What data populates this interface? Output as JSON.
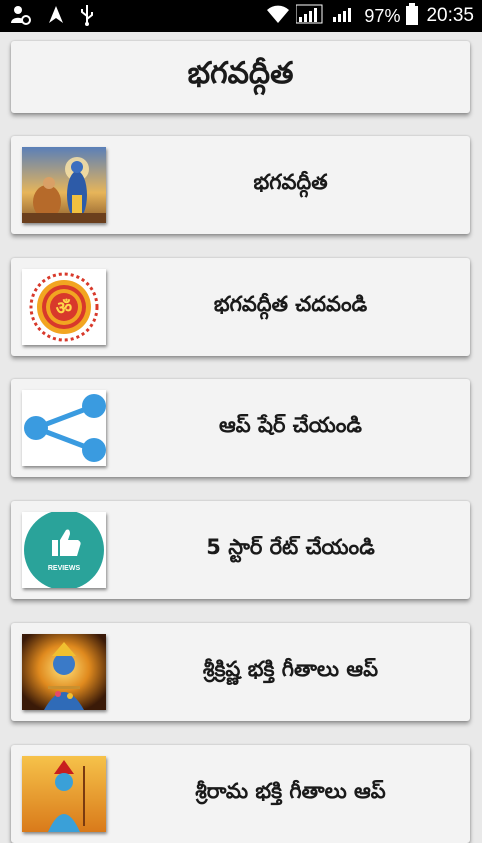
{
  "status_bar": {
    "battery": "97%",
    "time": "20:35",
    "icons": [
      "settings-person-icon",
      "navigation-icon",
      "usb-icon",
      "wifi-icon",
      "signal-icon",
      "signal-icon",
      "battery-icon"
    ]
  },
  "header": {
    "title": "భగవద్గీత"
  },
  "menu": {
    "items": [
      {
        "label": "భగవద్గీత",
        "thumb": "krishna-arjuna-image"
      },
      {
        "label": "భగవద్గీత చదవండి",
        "thumb": "om-mandala-image"
      },
      {
        "label": "ఆప్ షేర్ చేయండి",
        "thumb": "share-icon"
      },
      {
        "label": "5 స్టార్ రేట్ చేయండి",
        "thumb": "reviews-thumbs-up-icon",
        "thumb_text": "REVIEWS"
      },
      {
        "label": "శ్రీక్రిష్ణ భక్తి గీతాలు ఆప్",
        "thumb": "krishna-image"
      },
      {
        "label": "శ్రీరామ భక్తి గీతాలు ఆప్",
        "thumb": "rama-image"
      }
    ]
  },
  "colors": {
    "background": "#e9e9e9",
    "card": "#f3f3f3",
    "status_bar": "#000000",
    "share_blue": "#3a9be0",
    "reviews_teal": "#2aa39a",
    "om_red": "#d8392b",
    "om_orange": "#f2a521"
  }
}
